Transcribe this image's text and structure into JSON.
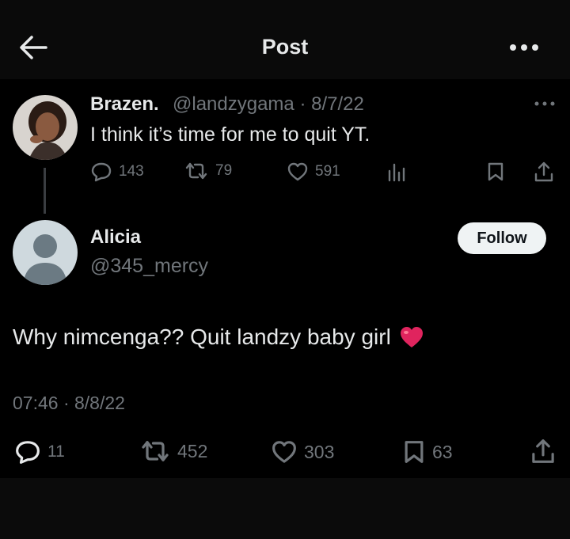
{
  "header": {
    "title": "Post",
    "back_icon": "arrow-left-icon",
    "more_icon": "more-horizontal-icon"
  },
  "parent_post": {
    "name": "Brazen.",
    "handle_date": "@landzygama · 8/7/22",
    "text": "I think it’s time for me to quit YT.",
    "replies": "143",
    "reposts": "79",
    "likes": "591"
  },
  "reply_post": {
    "name": "Alicia",
    "handle": "@345_mercy",
    "follow_label": "Follow",
    "text": "Why nimcenga?? Quit landzy baby girl",
    "emoji": "red-heart-emoji",
    "timestamp": "07:46 · 8/8/22",
    "replies": "11",
    "reposts": "452",
    "likes": "303",
    "bookmarks": "63"
  },
  "colors": {
    "background": "#000000",
    "text": "#e7e9ea",
    "muted": "#71767b",
    "follow_bg": "#eff3f4",
    "heart": "#e0245e"
  }
}
